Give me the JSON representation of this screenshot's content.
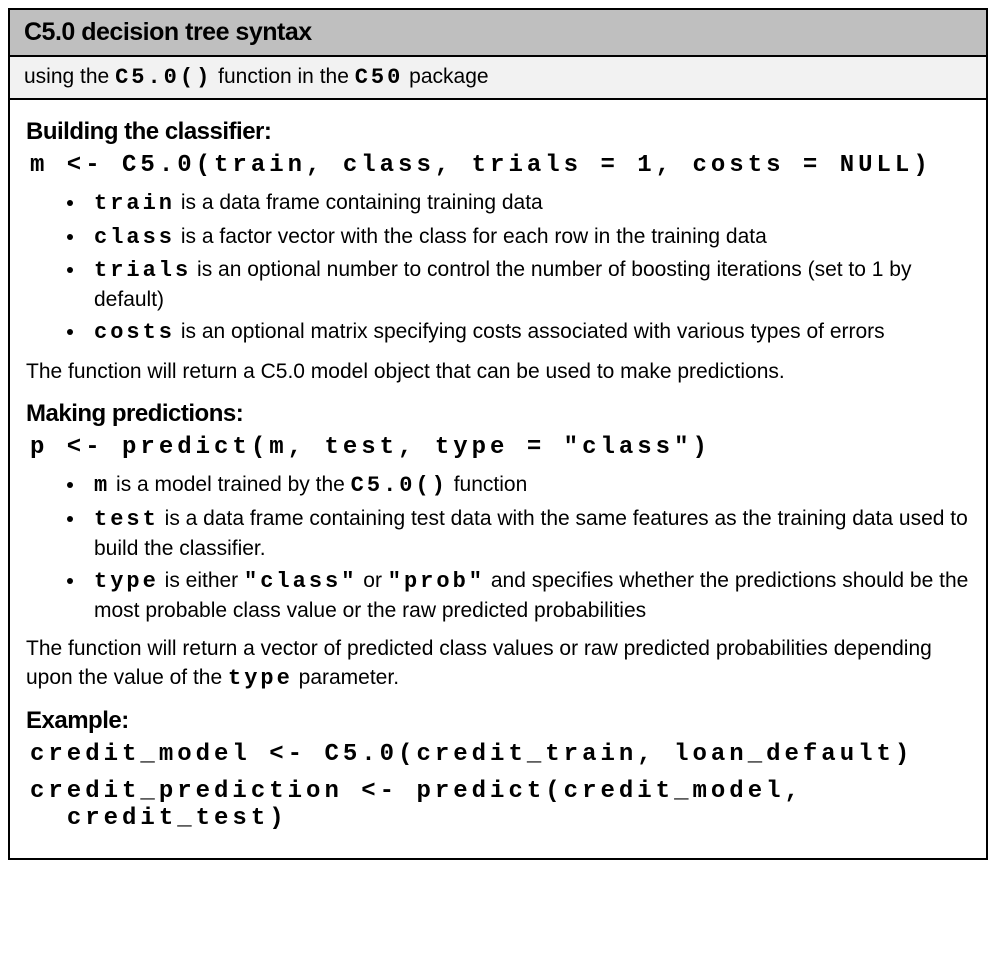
{
  "header": {
    "title": "C5.0 decision tree syntax"
  },
  "subheader": {
    "prefix": "using the ",
    "fn": "C5.0()",
    "mid": " function in the ",
    "pkg": "C50",
    "suffix": " package"
  },
  "build": {
    "title": "Building the classifier:",
    "code": "m <- C5.0(train, class, trials = 1, costs = NULL)",
    "params": [
      {
        "name": "train",
        "desc": " is a data frame containing training data"
      },
      {
        "name": "class",
        "desc": " is a factor vector with the class for each row in the training data"
      },
      {
        "name": "trials",
        "desc": " is an optional number to control the number of boosting iterations (set to 1 by default)"
      },
      {
        "name": "costs",
        "desc": " is an optional matrix specifying costs associated with various types of errors"
      }
    ],
    "note": "The function will return a C5.0 model object that can be used to make predictions."
  },
  "predict": {
    "title": "Making predictions:",
    "code": "p <- predict(m, test, type = \"class\")",
    "params": {
      "m_name": "m",
      "m_desc_a": " is a model trained by the ",
      "m_fn": "C5.0()",
      "m_desc_b": " function",
      "test_name": "test",
      "test_desc": " is a data frame containing test data with the same features as the training data used to build the classifier.",
      "type_name": "type",
      "type_a": " is either ",
      "type_class": "\"class\"",
      "type_or": " or ",
      "type_prob": "\"prob\"",
      "type_b": " and specifies whether the predictions should be the most probable class value or the raw predicted probabilities"
    },
    "note_a": "The function will return a vector of predicted class values or raw predicted probabilities depending upon the value of the ",
    "note_code": "type",
    "note_b": " parameter."
  },
  "example": {
    "title": "Example:",
    "line1": "credit_model <- C5.0(credit_train, loan_default)",
    "line2": "credit_prediction <- predict(credit_model,",
    "line3": "  credit_test)"
  }
}
